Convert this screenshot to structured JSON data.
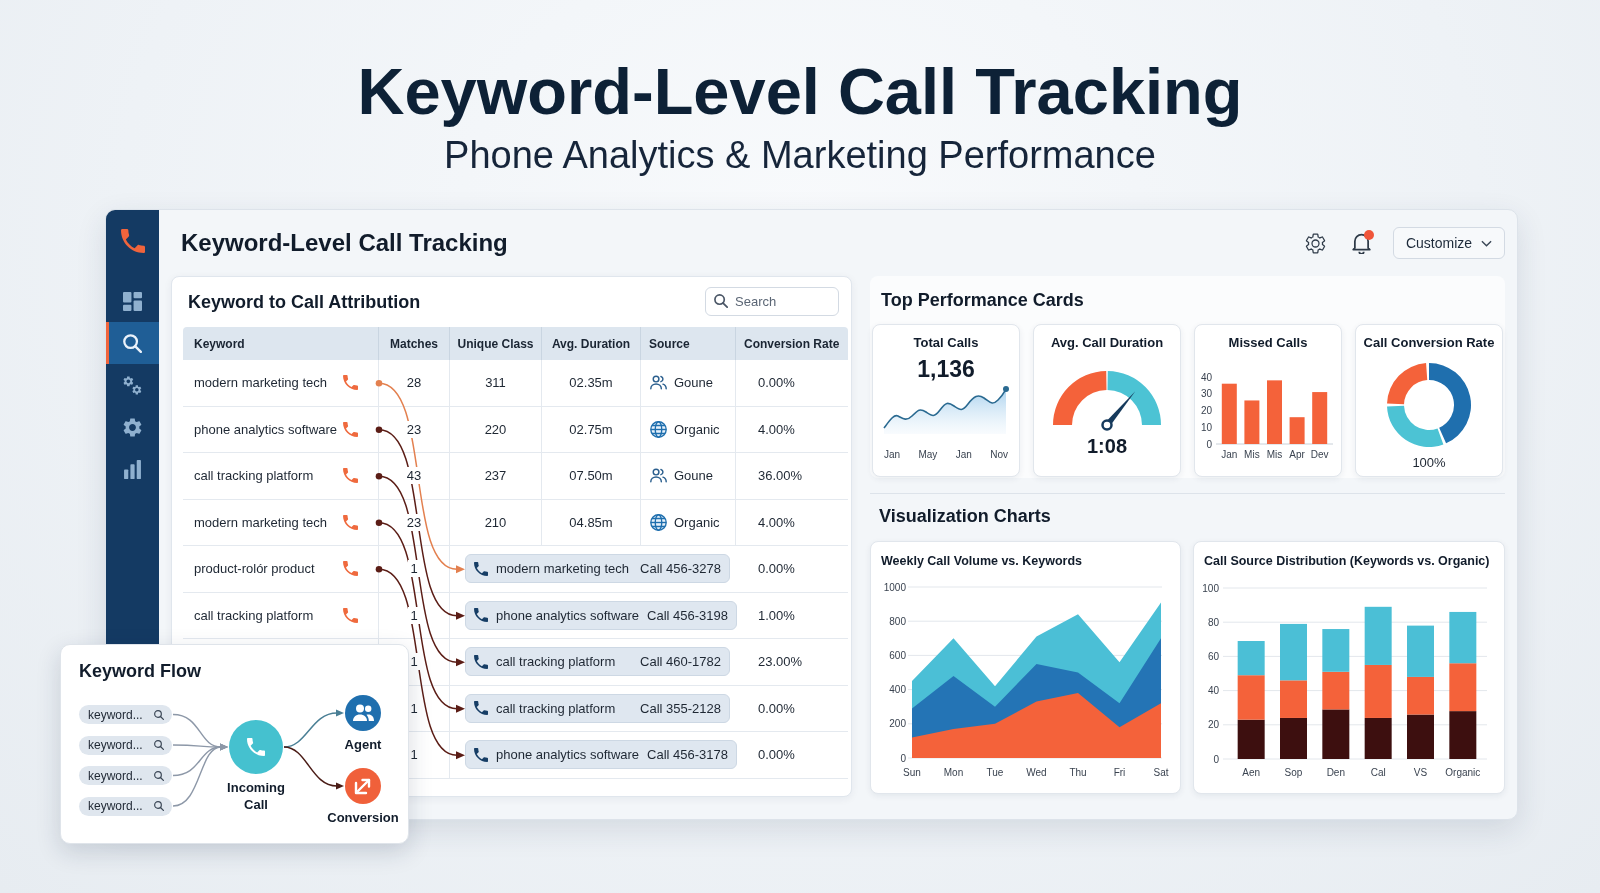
{
  "page": {
    "title": "Keyword-Level Call Tracking",
    "subtitle": "Phone Analytics & Marketing Performance"
  },
  "sidebar": {
    "items": [
      {
        "selected": false
      },
      {
        "selected": true
      },
      {
        "selected": false
      },
      {
        "selected": false
      },
      {
        "selected": false
      }
    ]
  },
  "header": {
    "title": "Keyword-Level Call Tracking",
    "notification_unread": true,
    "customize_button": "Customize"
  },
  "attribution": {
    "title": "Keyword to Call Attribution",
    "search": {
      "placeholder": "Search"
    },
    "columns": [
      "Keyword",
      "Matches",
      "Unique Class",
      "Avg. Duration",
      "Source",
      "Conversion Rate"
    ],
    "rows": [
      {
        "keyword": "modern marketing tech",
        "matches": "28",
        "unique_class": "311",
        "avg_duration": "02.35m",
        "source": {
          "label": "Goune",
          "kind": "people"
        },
        "conversion_rate": "0.00%"
      },
      {
        "keyword": "phone analytics software",
        "matches": "23",
        "unique_class": "220",
        "avg_duration": "02.75m",
        "source": {
          "label": "Organic",
          "kind": "globe"
        },
        "conversion_rate": "4.00%"
      },
      {
        "keyword": "call tracking platform",
        "matches": "43",
        "unique_class": "237",
        "avg_duration": "07.50m",
        "source": {
          "label": "Goune",
          "kind": "people"
        },
        "conversion_rate": "36.00%"
      },
      {
        "keyword": "modern marketing tech",
        "matches": "23",
        "unique_class": "210",
        "avg_duration": "04.85m",
        "source": {
          "label": "Organic",
          "kind": "globe"
        },
        "conversion_rate": "4.00%"
      },
      {
        "keyword": "product-rolór product",
        "matches": "1",
        "call": {
          "keyword": "modern marketing tech",
          "number": "Call 456-3278"
        },
        "conversion_rate": "0.00%"
      },
      {
        "keyword": "call tracking platform",
        "matches": "1",
        "call": {
          "keyword": "phone analytics software",
          "number": "Call 456-3198"
        },
        "conversion_rate": "1.00%"
      },
      {
        "matches": "1",
        "call": {
          "keyword": "call tracking platform",
          "number": "Call 460-1782"
        },
        "conversion_rate": "23.00%"
      },
      {
        "matches": "1",
        "call": {
          "keyword": "call tracking platform",
          "number": "Call 355-2128"
        },
        "conversion_rate": "0.00%"
      },
      {
        "matches": "1",
        "call": {
          "keyword": "phone analytics software",
          "number": "Call 456-3178"
        },
        "conversion_rate": "0.00%"
      }
    ]
  },
  "keyword_flow": {
    "title": "Keyword Flow",
    "inputs": [
      "keyword...",
      "keyword...",
      "keyword...",
      "keyword..."
    ],
    "hub": "Incoming Call",
    "outputs": [
      {
        "label": "Agent",
        "kind": "agent"
      },
      {
        "label": "Conversion",
        "kind": "conversion"
      }
    ]
  },
  "performance": {
    "title": "Top Performance Cards",
    "cards": [
      {
        "kind": "sparkline",
        "title": "Total Calls",
        "value": "1,136",
        "axis_labels": [
          "Jan",
          "May",
          "Jan",
          "Nov"
        ]
      },
      {
        "kind": "gauge",
        "title": "Avg. Call Duration",
        "value": "1:08"
      },
      {
        "kind": "bars",
        "title": "Missed Calls",
        "chart_data": {
          "type": "bar",
          "categories": [
            "Jan",
            "Mis",
            "Mis",
            "Apr",
            "Dev"
          ],
          "values": [
            36,
            26,
            38,
            16,
            31
          ],
          "color": "#f4623a",
          "ylim": [
            0,
            40
          ],
          "yticks": [
            0,
            10,
            20,
            30,
            40
          ]
        }
      },
      {
        "kind": "donut",
        "title": "Call Conversion Rate",
        "value": "100%"
      }
    ]
  },
  "visualization": {
    "title": "Visualization Charts",
    "charts": [
      {
        "title": "Weekly Call Volume vs. Keywords",
        "chart_data": {
          "type": "area",
          "categories": [
            "Sun",
            "Mon",
            "Tue",
            "Wed",
            "Thu",
            "Fri",
            "Sat"
          ],
          "series": [
            {
              "color": "#4bbfd6",
              "values": [
                450,
                700,
                420,
                710,
                840,
                560,
                910
              ]
            },
            {
              "color": "#2474b5",
              "values": [
                290,
                480,
                300,
                550,
                500,
                320,
                700
              ]
            },
            {
              "color": "#f4623a",
              "values": [
                120,
                170,
                200,
                330,
                380,
                180,
                320
              ]
            }
          ],
          "ylim": [
            0,
            1000
          ],
          "yticks": [
            0,
            200,
            400,
            600,
            800,
            1000
          ],
          "grid": true
        }
      },
      {
        "title": "Call Source Distribution (Keywords vs. Organic)",
        "chart_data": {
          "type": "bar",
          "stacked": true,
          "categories": [
            "Aen",
            "Sop",
            "Den",
            "Cal",
            "VS",
            "Organic"
          ],
          "series": [
            {
              "color": "#3d0f0f",
              "values": [
                23,
                24,
                29,
                24,
                26,
                28
              ]
            },
            {
              "color": "#f4623a",
              "values": [
                26,
                22,
                22,
                31,
                22,
                28
              ]
            },
            {
              "color": "#4bbfd6",
              "values": [
                20,
                33,
                25,
                34,
                30,
                30
              ]
            }
          ],
          "ylim": [
            0,
            100
          ],
          "yticks": [
            0,
            20,
            40,
            60,
            80,
            100
          ],
          "grid": true
        }
      }
    ]
  }
}
